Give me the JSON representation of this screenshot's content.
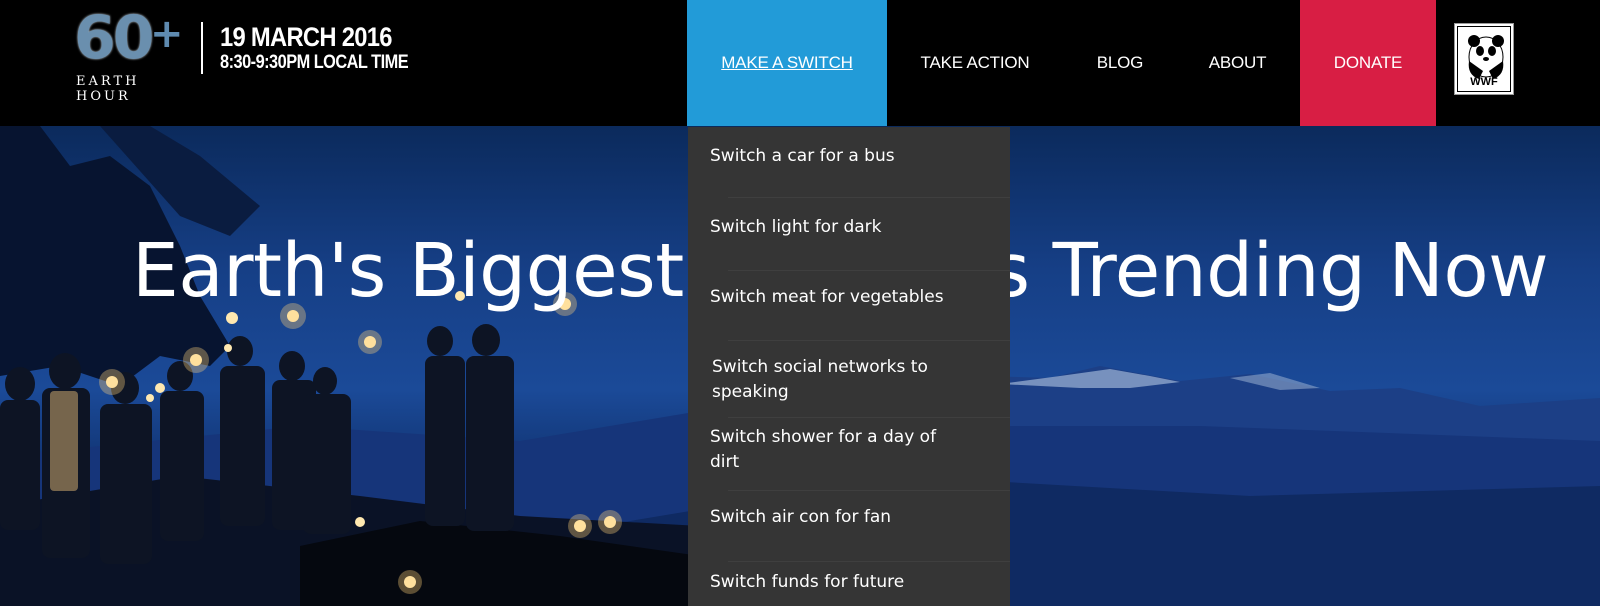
{
  "header": {
    "logo": {
      "number": "60",
      "plus": "+",
      "line1": "EARTH",
      "line2": "HOUR"
    },
    "event_date": "19 MARCH 2016",
    "event_time": "8:30-9:30PM LOCAL TIME"
  },
  "nav": {
    "make_a_switch": "MAKE A SWITCH",
    "take_action": "TAKE ACTION",
    "blog": "BLOG",
    "about": "ABOUT",
    "donate": "DONATE",
    "partner_logo_text": "WWF"
  },
  "hero": {
    "title": "Earth's Biggest Switch is Trending Now"
  },
  "dropdown": {
    "items": [
      "Switch a car for a bus",
      "Switch light for dark",
      "Switch meat for vegetables",
      "Switch social networks to speaking",
      "Switch shower for a day of dirt",
      "Switch air con for fan",
      "Switch funds for future"
    ]
  },
  "colors": {
    "header_bg": "#000000",
    "nav_active": "#229bd8",
    "donate": "#d81e44",
    "dropdown_bg": "#353535"
  },
  "icons": {
    "logo": "earth-hour-logo",
    "partner": "wwf-panda-logo"
  }
}
